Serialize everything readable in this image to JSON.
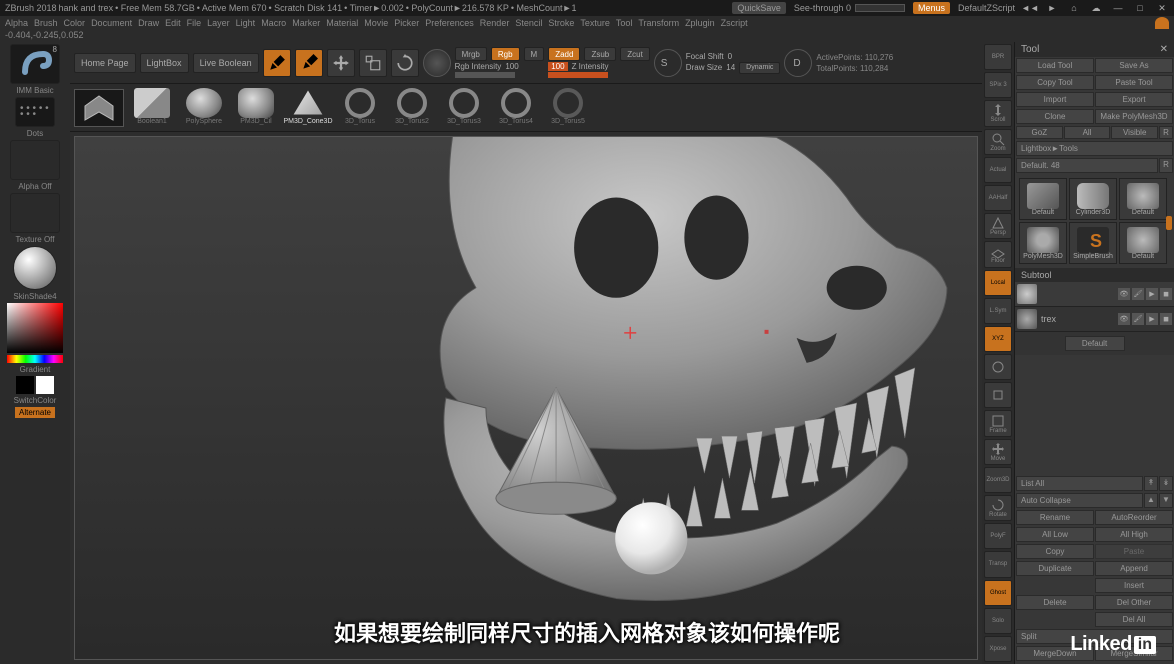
{
  "titlebar": {
    "app": "ZBrush 2018",
    "doc": "hank and trex",
    "freemem": "• Free Mem 58.7GB",
    "activemem": "• Active Mem 670",
    "scratch": "• Scratch Disk 141",
    "timer": "• Timer►0.002",
    "polycount": "• PolyCount►216.578 KP",
    "meshcount": "• MeshCount►1",
    "quicksave": "QuickSave",
    "seethrough": "See-through  0",
    "menus": "Menus",
    "zscript": "DefaultZScript"
  },
  "menu": [
    "Alpha",
    "Brush",
    "Color",
    "Document",
    "Draw",
    "Edit",
    "File",
    "Layer",
    "Light",
    "Macro",
    "Marker",
    "Material",
    "Movie",
    "Picker",
    "Preferences",
    "Render",
    "Stencil",
    "Stroke",
    "Texture",
    "Tool",
    "Transform",
    "Zplugin",
    "Zscript"
  ],
  "coords": "-0.404,-0.245,0.052",
  "toolbar": {
    "homepage": "Home Page",
    "lightbox": "LightBox",
    "liveboolean": "Live Boolean",
    "edit": "Edit",
    "draw": "Draw",
    "move": "Move",
    "scale": "Scale",
    "rotate": "Rotate",
    "mrgb": "Mrgb",
    "rgb": "Rgb",
    "m": "M",
    "zadd": "Zadd",
    "zsub": "Zsub",
    "zcut": "Zcut",
    "rgbintensity_label": "Rgb Intensity",
    "rgbintensity_val": "100",
    "zintensity_label": "Z Intensity",
    "zintensity_val": "100",
    "focalshift_label": "Focal Shift",
    "focalshift_val": "0",
    "drawsize_label": "Draw Size",
    "drawsize_val": "14",
    "dynamic": "Dynamic",
    "activepoints_label": "ActivePoints:",
    "activepoints_val": "110,276",
    "totalpoints_label": "TotalPoints:",
    "totalpoints_val": "110,284"
  },
  "brushshelf": {
    "items": [
      "Boolean1",
      "PolySphere",
      "PM3D_Cil",
      "PM3D_Cone3D",
      "3D_Torus",
      "3D_Torus2",
      "3D_Torus3",
      "3D_Torus4",
      "3D_Torus5"
    ]
  },
  "leftpanel": {
    "brush": "IMM Basic",
    "stroke": "Dots",
    "alpha": "Alpha Off",
    "texture": "Texture Off",
    "material": "SkinShade4",
    "gradient": "Gradient",
    "switchcolor": "SwitchColor",
    "alternate": "Alternate"
  },
  "rightstrip": [
    "BPR",
    "SPix 3",
    "Scroll",
    "Zoom",
    "Actual",
    "AAHalf",
    "Persp",
    "Floor",
    "Local",
    "L.Sym",
    "XYZ",
    "",
    "",
    "Frame",
    "Move",
    "Zoom3D",
    "Rotate",
    "PolyF",
    "Transp",
    "Ghost",
    "Solo",
    "Xpose"
  ],
  "rightpanel": {
    "title": "Tool",
    "loadtool": "Load Tool",
    "saveas": "Save As",
    "copytool": "Copy Tool",
    "pastetool": "Paste Tool",
    "import": "Import",
    "export": "Export",
    "clone": "Clone",
    "makepolymesh": "Make PolyMesh3D",
    "goz": "GoZ",
    "all": "All",
    "visible": "Visible",
    "r": "R",
    "lightbox_tools": "Lightbox►Tools",
    "default_slider": "Default.",
    "default_val": "48",
    "tools": [
      {
        "label": "Default"
      },
      {
        "label": "Cylinder3D"
      },
      {
        "label": "Default"
      },
      {
        "label": "PolyMesh3D"
      },
      {
        "label": "SimpleBrush"
      },
      {
        "label": "Default"
      }
    ],
    "subtool": "Subtool",
    "subtools": [
      {
        "name": ""
      },
      {
        "name": "trex"
      }
    ],
    "subtool_btn": "Default",
    "listall": "List All",
    "autocollapse": "Auto Collapse",
    "rename": "Rename",
    "autoreorder": "AutoReorder",
    "alllow": "All Low",
    "allhigh": "All High",
    "copy": "Copy",
    "paste": "Paste",
    "duplicate": "Duplicate",
    "append": "Append",
    "insert": "Insert",
    "delete": "Delete",
    "delother": "Del Other",
    "delall": "Del All",
    "split": "Split",
    "mergedown": "MergeDown",
    "mergesimilar": "MergeSimilar"
  },
  "subtitle": "如果想要绘制同样尺寸的插入网格对象该如何操作呢"
}
